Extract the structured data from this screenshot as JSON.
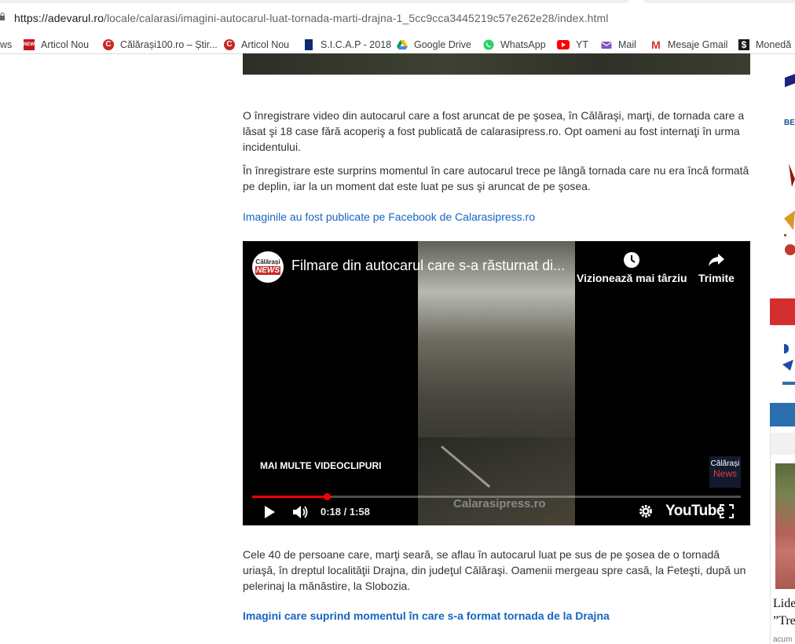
{
  "browser": {
    "url_host": "https://adevarul.ro",
    "url_path": "/locale/calarasi/imagini-autocarul-luat-tornada-marti-drajna-1_5cc9cca3445219c57e262e28/index.html"
  },
  "bookmarks": [
    {
      "label": "ws",
      "icon": "none"
    },
    {
      "label": "Articol Nou",
      "icon": "news-icon"
    },
    {
      "label": "Călărași100.ro – Știr...",
      "icon": "calarasi100-icon"
    },
    {
      "label": "Articol Nou",
      "icon": "calarasi100-icon"
    },
    {
      "label": "S.I.C.A.P - 2018",
      "icon": "sicap-icon"
    },
    {
      "label": "Google Drive",
      "icon": "google-drive-icon"
    },
    {
      "label": "WhatsApp",
      "icon": "whatsapp-icon"
    },
    {
      "label": "YT",
      "icon": "youtube-icon"
    },
    {
      "label": "Mail",
      "icon": "mail-icon"
    },
    {
      "label": "Mesaje Gmail",
      "icon": "gmail-icon"
    },
    {
      "label": "Monedă",
      "icon": "dollar-icon"
    }
  ],
  "article": {
    "para1": "O înregistrare video din autocarul care a fost aruncat de pe şosea, în Călăraşi, marţi, de tornada care a lăsat şi 18 case fără acoperiş a fost publicată de calarasipress.ro. Opt oameni au fost internaţi în urma incidentului.",
    "para2": "În înregistrare este surprins momentul în care autocarul trece pe lângă tornada care nu era încă formată pe deplin, iar la un moment dat este luat pe sus şi aruncat de pe şosea.",
    "link1": "Imaginile au fost publicate pe Facebook de Calarasipress.ro",
    "para3": "Cele 40 de persoane care, marţi seară, se aflau în autocarul luat pe sus de pe şosea de o tornadă uriaşă, în dreptul localităţii Drajna, din judeţul Călăraşi. Oamenii mergeau spre casă, la Feteşti, după un pelerinaj la mănăstire, la Slobozia.",
    "link2": "Imagini care suprind momentul în care s-a format tornada de la Drajna"
  },
  "video": {
    "channel_logo_top": "Călărași",
    "channel_logo_bottom": "NEWS",
    "title": "Filmare din autocarul care s-a răsturnat di...",
    "watch_later_label": "Vizionează mai târziu",
    "share_label": "Trimite",
    "more_videos_label": "MAI MULTE VIDEOCLIPURI",
    "watermark_logo_top": "Călărași",
    "watermark_logo_bottom": "News",
    "watermark_text": "Calarasipress.ro",
    "time": "0:18 / 1:58",
    "progress_fraction": 0.153,
    "brand": "YouTube"
  },
  "sidebar": {
    "be_text": "BE",
    "card_title_line1": "Lide",
    "card_title_line2": "”Tre",
    "card_meta": "acum"
  }
}
